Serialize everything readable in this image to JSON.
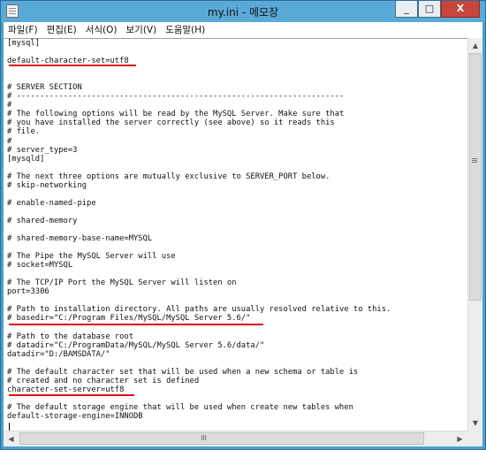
{
  "window": {
    "title": "my.ini - 메모장",
    "buttons": {
      "minimize": "_",
      "maximize": "□",
      "close": "X"
    }
  },
  "menu": [
    "파일(F)",
    "편집(E)",
    "서식(O)",
    "보기(V)",
    "도움말(H)"
  ],
  "colors": {
    "titlebar": "#5aaad8",
    "underline": "#e01010",
    "close_button": "#c7453b"
  },
  "lines": [
    "[mysql]",
    "",
    "default-character-set=utf8",
    "",
    "",
    "# SERVER SECTION",
    "# ----------------------------------------------------------------------",
    "#",
    "# The following options will be read by the MySQL Server. Make sure that",
    "# you have installed the server correctly (see above) so it reads this",
    "# file.",
    "#",
    "# server_type=3",
    "[mysqld]",
    "",
    "# The next three options are mutually exclusive to SERVER_PORT below.",
    "# skip-networking",
    "",
    "# enable-named-pipe",
    "",
    "# shared-memory",
    "",
    "# shared-memory-base-name=MYSQL",
    "",
    "# The Pipe the MySQL Server will use",
    "# socket=MYSQL",
    "",
    "# The TCP/IP Port the MySQL Server will listen on",
    "port=3306",
    "",
    "# Path to installation directory. All paths are usually resolved relative to this.",
    "# basedir=\"C:/Program Files/MySQL/MySQL Server 5.6/\"",
    "",
    "# Path to the database root",
    "# datadir=\"C:/ProgramData/MySQL/MySQL Server 5.6/data/\"",
    "datadir=\"D:/BAMSDATA/\"",
    "",
    "# The default character set that will be used when a new schema or table is",
    "# created and no character set is defined",
    "character-set-server=utf8",
    "",
    "# The default storage engine that will be used when create new tables when",
    "default-storage-engine=INNODB"
  ]
}
